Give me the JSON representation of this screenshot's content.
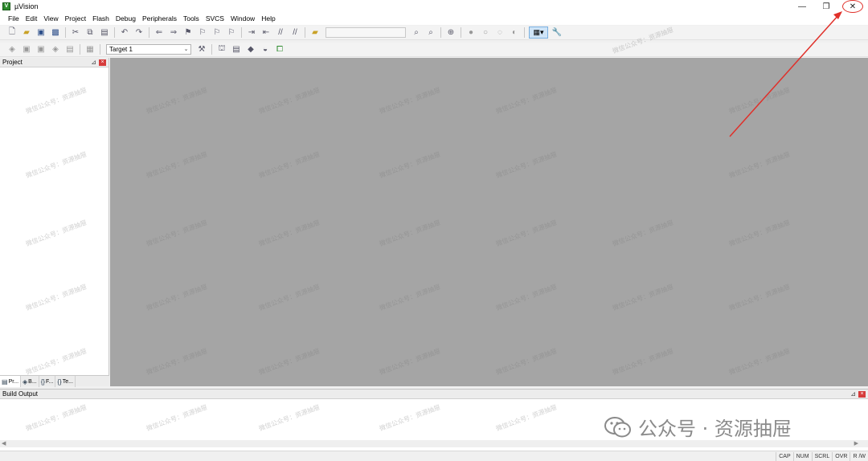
{
  "window": {
    "title": "µVision",
    "minimize_glyph": "—",
    "restore_glyph": "❐",
    "close_glyph": "✕"
  },
  "menu": [
    "File",
    "Edit",
    "View",
    "Project",
    "Flash",
    "Debug",
    "Peripherals",
    "Tools",
    "SVCS",
    "Window",
    "Help"
  ],
  "toolbar2": {
    "target": "Target 1"
  },
  "project_panel": {
    "title": "Project",
    "tabs": [
      {
        "icon": "project-tab-icon",
        "label": "Pr..."
      },
      {
        "icon": "books-tab-icon",
        "label": "B..."
      },
      {
        "icon": "functions-tab-icon",
        "label": "F..."
      },
      {
        "icon": "templates-tab-icon",
        "label": "Te..."
      }
    ],
    "tab_glyphs": [
      "▤",
      "◈",
      "{}",
      "{}"
    ]
  },
  "build_output": {
    "title": "Build Output"
  },
  "status": [
    "CAP",
    "NUM",
    "SCRL",
    "OVR",
    "R /W"
  ],
  "watermark": {
    "brand": "公众号 · 资源抽屉",
    "repeat_text": "微信公众号：资源抽屉"
  },
  "colors": {
    "editor_bg": "#a5a5a5",
    "annotation": "#e0302a",
    "close_icon": "#d63c3c"
  }
}
